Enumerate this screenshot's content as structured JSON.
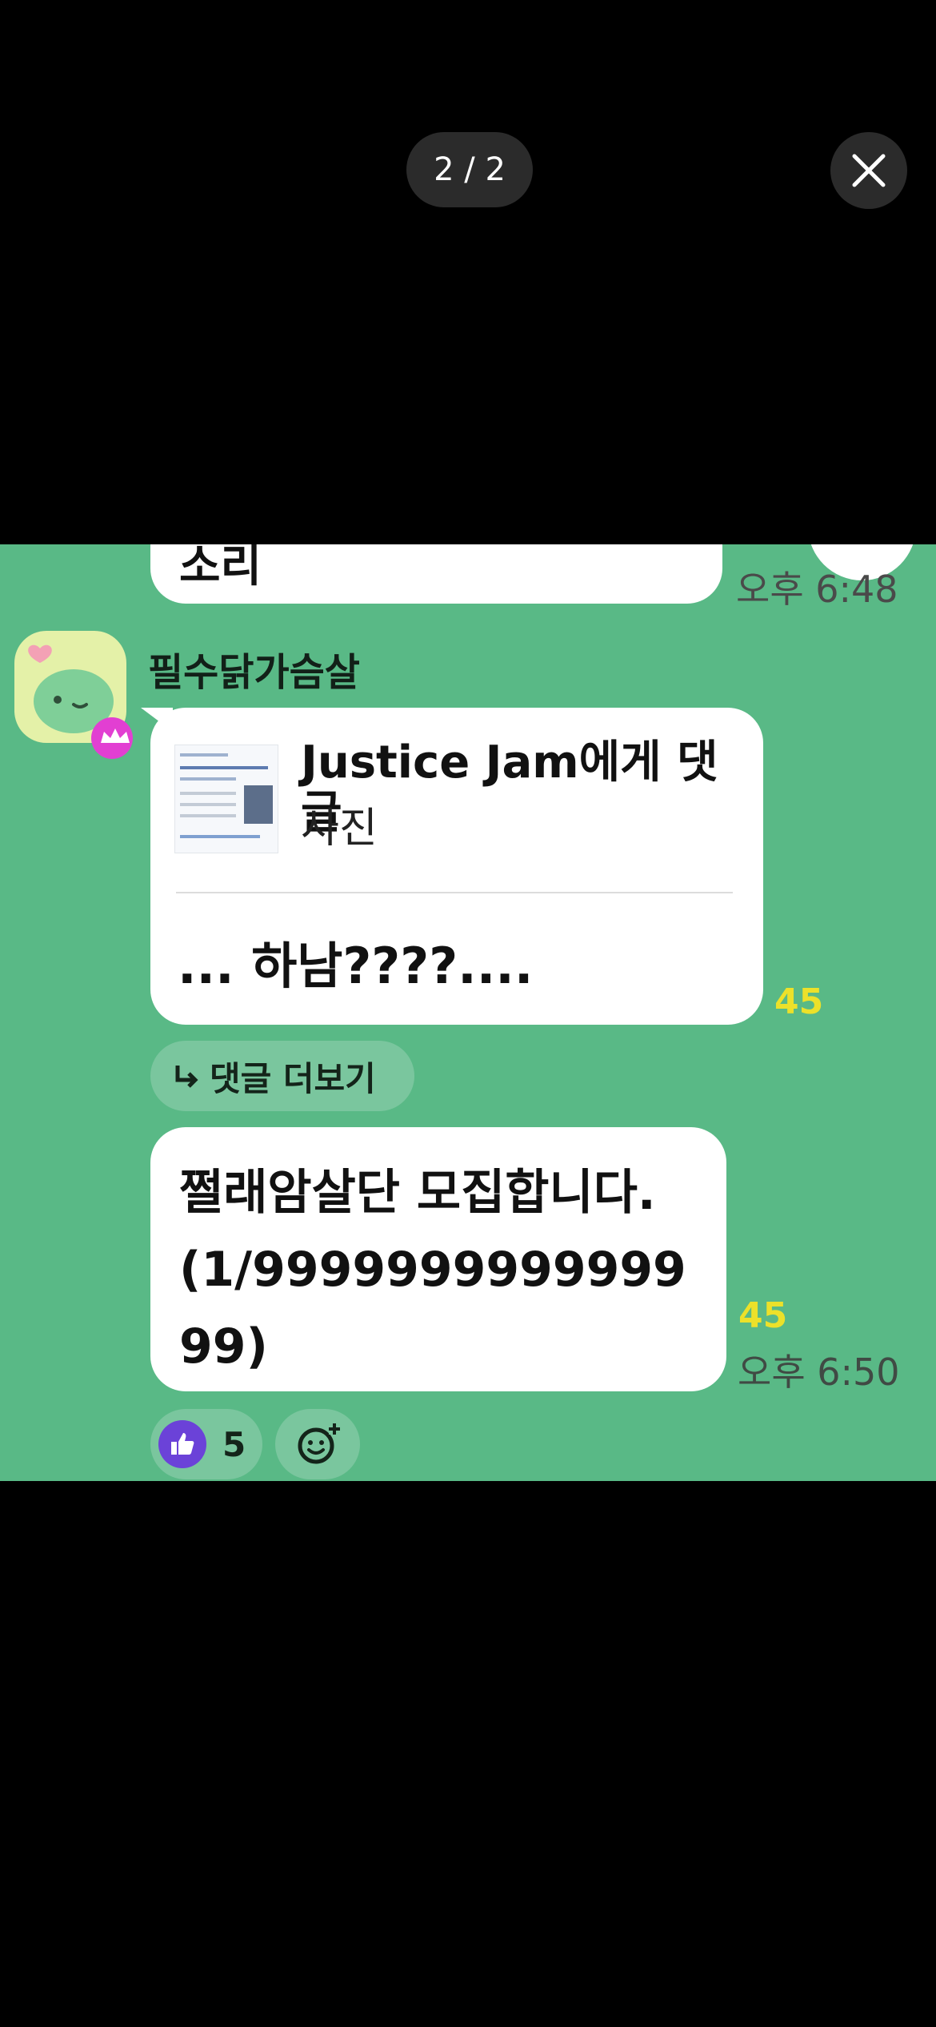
{
  "viewer": {
    "counter": "2 / 2",
    "close_icon": "close-icon"
  },
  "chat": {
    "top_bubble_text": "소리",
    "top_time": "오후 6:48",
    "sender_name": "필수닭가슴살",
    "link_preview": {
      "title": "Justice Jam에게 댓글",
      "subtitle": "사진"
    },
    "message1": "... 하남????....",
    "read_count1": "45",
    "more_comments_label": "댓글 더보기",
    "message2": "쩔래암살단 모집합니다. (1/999999999999999)",
    "read_count2": "45",
    "time2": "오후 6:50",
    "reaction_count": "5"
  },
  "colors": {
    "chat_bg": "#59b986",
    "bubble": "#ffffff",
    "read_count": "#ece12a",
    "like": "#6b42d8",
    "crown_badge": "#e23fd2"
  }
}
